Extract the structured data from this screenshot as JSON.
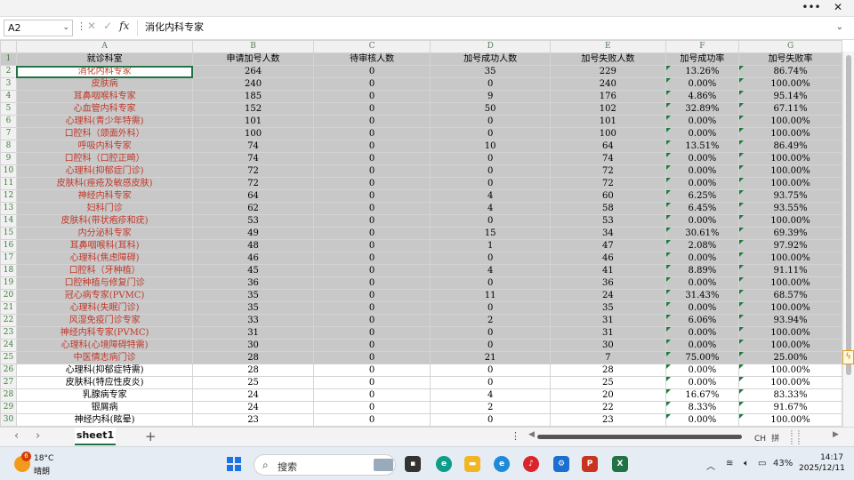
{
  "window": {
    "more_label": "•••",
    "close_label": "✕"
  },
  "formula_bar": {
    "name_box": "A2",
    "formula_value": "消化内科专家",
    "icons": [
      "more-vertical-icon",
      "cancel-x-icon",
      "confirm-check-icon",
      "fx-icon"
    ]
  },
  "column_headers": [
    "A",
    "B",
    "C",
    "D",
    "E",
    "F",
    "G"
  ],
  "table": {
    "headers": [
      "就诊科室",
      "申请加号人数",
      "待审核人数",
      "加号成功人数",
      "加号失败人数",
      "加号成功率",
      "加号失败率"
    ],
    "rows": [
      [
        "消化内科专家",
        "264",
        "0",
        "35",
        "229",
        "13.26%",
        "86.74%"
      ],
      [
        "皮肤病",
        "240",
        "0",
        "0",
        "240",
        "0.00%",
        "100.00%"
      ],
      [
        "耳鼻咽喉科专家",
        "185",
        "0",
        "9",
        "176",
        "4.86%",
        "95.14%"
      ],
      [
        "心血管内科专家",
        "152",
        "0",
        "50",
        "102",
        "32.89%",
        "67.11%"
      ],
      [
        "心理科(青少年特需)",
        "101",
        "0",
        "0",
        "101",
        "0.00%",
        "100.00%"
      ],
      [
        "口腔科（颌面外科）",
        "100",
        "0",
        "0",
        "100",
        "0.00%",
        "100.00%"
      ],
      [
        "呼吸内科专家",
        "74",
        "0",
        "10",
        "64",
        "13.51%",
        "86.49%"
      ],
      [
        "口腔科（口腔正畸）",
        "74",
        "0",
        "0",
        "74",
        "0.00%",
        "100.00%"
      ],
      [
        "心理科(抑郁症门诊)",
        "72",
        "0",
        "0",
        "72",
        "0.00%",
        "100.00%"
      ],
      [
        "皮肤科(痤疮及敏感皮肤)",
        "72",
        "0",
        "0",
        "72",
        "0.00%",
        "100.00%"
      ],
      [
        "神经内科专家",
        "64",
        "0",
        "4",
        "60",
        "6.25%",
        "93.75%"
      ],
      [
        "妇科门诊",
        "62",
        "0",
        "4",
        "58",
        "6.45%",
        "93.55%"
      ],
      [
        "皮肤科(带状疱疹和疣)",
        "53",
        "0",
        "0",
        "53",
        "0.00%",
        "100.00%"
      ],
      [
        "内分泌科专家",
        "49",
        "0",
        "15",
        "34",
        "30.61%",
        "69.39%"
      ],
      [
        "耳鼻咽喉科(耳科)",
        "48",
        "0",
        "1",
        "47",
        "2.08%",
        "97.92%"
      ],
      [
        "心理科(焦虑障碍)",
        "46",
        "0",
        "0",
        "46",
        "0.00%",
        "100.00%"
      ],
      [
        "口腔科（牙种植）",
        "45",
        "0",
        "4",
        "41",
        "8.89%",
        "91.11%"
      ],
      [
        "口腔种植与修复门诊",
        "36",
        "0",
        "0",
        "36",
        "0.00%",
        "100.00%"
      ],
      [
        "冠心病专家(PVMC)",
        "35",
        "0",
        "11",
        "24",
        "31.43%",
        "68.57%"
      ],
      [
        "心理科(失眠门诊)",
        "35",
        "0",
        "0",
        "35",
        "0.00%",
        "100.00%"
      ],
      [
        "风湿免疫门诊专家",
        "33",
        "0",
        "2",
        "31",
        "6.06%",
        "93.94%"
      ],
      [
        "神经内科专家(PVMC)",
        "31",
        "0",
        "0",
        "31",
        "0.00%",
        "100.00%"
      ],
      [
        "心理科(心境障碍特需)",
        "30",
        "0",
        "0",
        "30",
        "0.00%",
        "100.00%"
      ],
      [
        "中医情志病门诊",
        "28",
        "0",
        "21",
        "7",
        "75.00%",
        "25.00%"
      ],
      [
        "心理科(抑郁症特需)",
        "28",
        "0",
        "0",
        "28",
        "0.00%",
        "100.00%"
      ],
      [
        "皮肤科(特应性皮炎)",
        "25",
        "0",
        "0",
        "25",
        "0.00%",
        "100.00%"
      ],
      [
        "乳腺病专家",
        "24",
        "0",
        "4",
        "20",
        "16.67%",
        "83.33%"
      ],
      [
        "银屑病",
        "24",
        "0",
        "2",
        "22",
        "8.33%",
        "91.67%"
      ],
      [
        "神经内科(眩晕)",
        "23",
        "0",
        "0",
        "23",
        "0.00%",
        "100.00%"
      ]
    ],
    "highlight_rows": 24
  },
  "sheet_tabs": {
    "active": "sheet1",
    "add_label": "+",
    "more_label": "⋮"
  },
  "status": {
    "ime_ch": "CH",
    "ime_mode": "拼"
  },
  "taskbar": {
    "weather_temp": "18°C",
    "weather_cond": "晴朗",
    "weather_badge": "6",
    "search_placeholder": "搜索",
    "battery": "43%",
    "time": "14:17",
    "date": "2025/12/11",
    "accent": "#217346"
  }
}
